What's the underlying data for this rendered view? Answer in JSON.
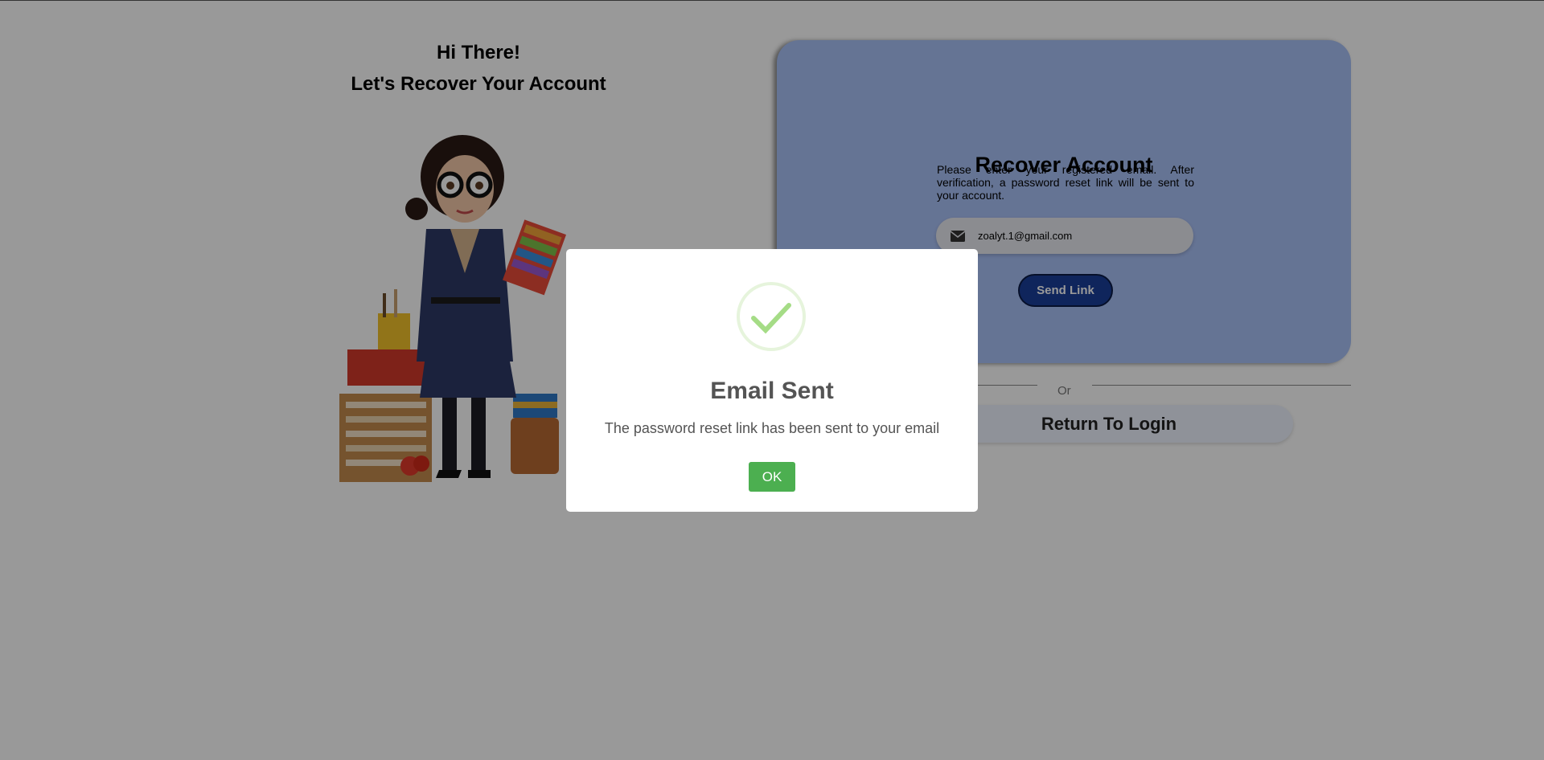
{
  "hero": {
    "line1": "Hi There!",
    "line2": "Let's Recover Your Account"
  },
  "recover_card": {
    "title": "Recover Account",
    "description": "Please enter your registered email. After verification, a password reset link will be sent to your account.",
    "email_value": "zoalyt.1@gmail.com",
    "email_icon": "envelope-icon",
    "send_button": "Send Link",
    "separator": "Or",
    "return_button": "Return To Login"
  },
  "modal": {
    "icon": "success-check-icon",
    "title": "Email Sent",
    "message": "The password reset link has been sent to your email",
    "ok_button": "OK"
  },
  "colors": {
    "card_bg": "#a9c1f7",
    "send_button_bg": "#1a3f9a",
    "ok_button_bg": "#4caf50",
    "success_check": "#a5dc86",
    "overlay": "rgba(0,0,0,0.4)"
  }
}
